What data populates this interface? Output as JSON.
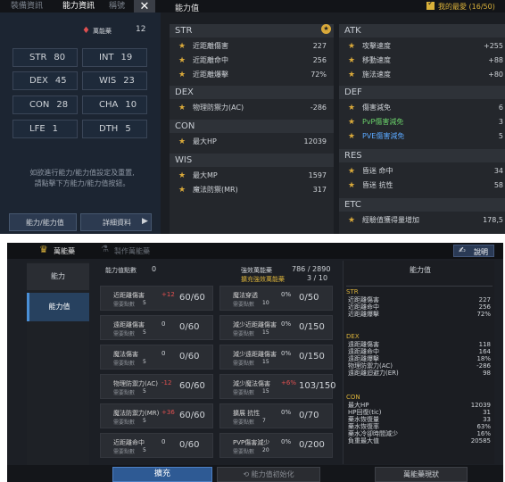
{
  "top": {
    "tabs": [
      "裝備資訊",
      "能力資訊",
      "稱號"
    ],
    "right_title": "能力值",
    "my_fav": "我的最愛 (16/50)"
  },
  "left": {
    "title": "萬能藥",
    "count": "12",
    "stats": [
      {
        "n": "STR",
        "v": "80"
      },
      {
        "n": "INT",
        "v": "19"
      },
      {
        "n": "DEX",
        "v": "45"
      },
      {
        "n": "WIS",
        "v": "23"
      },
      {
        "n": "CON",
        "v": "28"
      },
      {
        "n": "CHA",
        "v": "10"
      },
      {
        "n": "LFE",
        "v": "1"
      },
      {
        "n": "DTH",
        "v": "5"
      }
    ],
    "note1": "如欲進行能力/能力值設定及重置,",
    "note2": "請點擊下方能力/能力值按鈕。",
    "btn1": "能力/能力值",
    "btn2": "詳細資料"
  },
  "mid": {
    "str": {
      "h": "STR",
      "rows": [
        {
          "l": "近距離傷害",
          "v": "227"
        },
        {
          "l": "近距離命中",
          "v": "256"
        },
        {
          "l": "近距離爆擊",
          "v": "72%"
        }
      ]
    },
    "dex": {
      "h": "DEX",
      "rows": [
        {
          "l": "物理防禦力(AC)",
          "v": "-286"
        }
      ]
    },
    "con": {
      "h": "CON",
      "rows": [
        {
          "l": "最大HP",
          "v": "12039"
        }
      ]
    },
    "wis": {
      "h": "WIS",
      "rows": [
        {
          "l": "最大MP",
          "v": "1597"
        },
        {
          "l": "魔法防禦(MR)",
          "v": "317"
        }
      ]
    }
  },
  "right": {
    "atk": {
      "h": "ATK",
      "rows": [
        {
          "l": "攻擊速度",
          "v": "+255"
        },
        {
          "l": "移動速度",
          "v": "+88"
        },
        {
          "l": "施法速度",
          "v": "+80"
        }
      ]
    },
    "def": {
      "h": "DEF",
      "rows": [
        {
          "l": "傷害減免",
          "v": "6"
        },
        {
          "l": "PvP傷害減免",
          "v": "3"
        },
        {
          "l": "PVE傷害減免",
          "v": "5"
        }
      ]
    },
    "res": {
      "h": "RES",
      "rows": [
        {
          "l": "昏迷 命中",
          "v": "34"
        },
        {
          "l": "昏迷 抗性",
          "v": "58"
        }
      ]
    },
    "etc": {
      "h": "ETC",
      "rows": [
        {
          "l": "經驗值獲得量增加",
          "v": "178,5"
        }
      ]
    }
  },
  "p2": {
    "tab1": "萬能藥",
    "tab2": "製作萬能藥",
    "help": "說明",
    "side1": "能力",
    "side2": "能力值",
    "ab_label": "能力值點數",
    "ab_val": "0",
    "ul": "強效萬能藥",
    "ul_v": "786 / 2890",
    "ul2": "擴充強效萬能藥",
    "ul2_v": "3 / 10",
    "cards": [
      {
        "n": "近距離傷害",
        "s": "需要點數",
        "p": "5",
        "i": "+12",
        "pr": "60/60"
      },
      {
        "n": "魔法穿透",
        "s": "需要點數",
        "p": "10",
        "i": "0%",
        "pr": "0/50"
      },
      {
        "n": "遠距離傷害",
        "s": "需要點數",
        "p": "5",
        "i": "0",
        "pr": "0/60"
      },
      {
        "n": "減少近距離傷害",
        "s": "需要點數",
        "p": "15",
        "i": "0%",
        "pr": "0/150"
      },
      {
        "n": "魔法傷害",
        "s": "需要點數",
        "p": "5",
        "i": "0",
        "pr": "0/60"
      },
      {
        "n": "減少遠距離傷害",
        "s": "需要點數",
        "p": "15",
        "i": "0%",
        "pr": "0/150"
      },
      {
        "n": "物理防禦力(AC)",
        "s": "需要點數",
        "p": "5",
        "i": "-12",
        "pr": "60/60"
      },
      {
        "n": "減少魔法傷害",
        "s": "需要點數",
        "p": "15",
        "i": "+6%",
        "pr": "103/150"
      },
      {
        "n": "魔法防禦力(MR)",
        "s": "需要點數",
        "p": "5",
        "i": "+36",
        "pr": "60/60"
      },
      {
        "n": "擴展 抗性",
        "s": "需要點數",
        "p": "7",
        "i": "0%",
        "pr": "0/70"
      },
      {
        "n": "近距離命中",
        "s": "需要點數",
        "p": "5",
        "i": "0",
        "pr": "0/60"
      },
      {
        "n": "PVP傷害減少",
        "s": "需要點數",
        "p": "20",
        "i": "0%",
        "pr": "0/200"
      }
    ],
    "rtitle": "能力值",
    "str": {
      "h": "STR",
      "rows": [
        {
          "l": "近距離傷害",
          "v": "227"
        },
        {
          "l": "近距離命中",
          "v": "256"
        },
        {
          "l": "近距離爆擊",
          "v": "72%"
        }
      ]
    },
    "dex": {
      "h": "DEX",
      "rows": [
        {
          "l": "遠距離傷害",
          "v": "118"
        },
        {
          "l": "遠距離命中",
          "v": "164"
        },
        {
          "l": "遠距離爆擊",
          "v": "18%"
        },
        {
          "l": "物理防禦力(AC)",
          "v": "-286"
        },
        {
          "l": "遠距離迴避力(ER)",
          "v": "98"
        }
      ]
    },
    "con": {
      "h": "CON",
      "rows": [
        {
          "l": "最大HP",
          "v": "12039"
        },
        {
          "l": "HP回復(tic)",
          "v": "31"
        },
        {
          "l": "藥水恢復量",
          "v": "33"
        },
        {
          "l": "藥水恢復率",
          "v": "63%"
        },
        {
          "l": "藥水冷卻時間減少",
          "v": "16%"
        },
        {
          "l": "負重最大值",
          "v": "20585"
        }
      ]
    },
    "b1": "擴充",
    "b2": "能力值初始化",
    "b3": "萬能藥現狀"
  }
}
